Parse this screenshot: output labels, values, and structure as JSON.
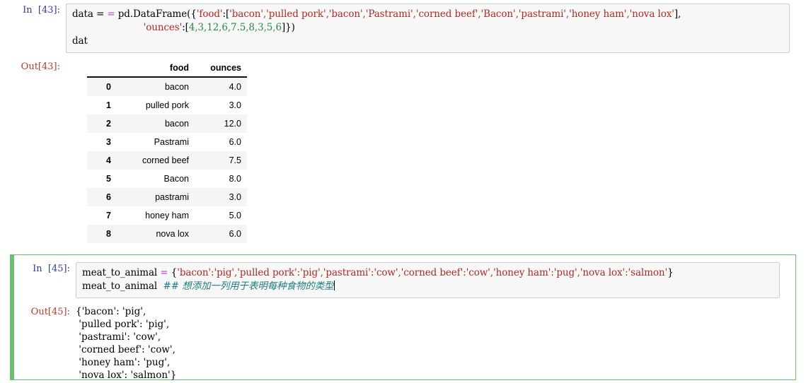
{
  "notebook": {
    "cells": [
      {
        "prompt_in": "In  [43]:",
        "prompt_out": "Out[43]:",
        "code_line_1_a": "data = ",
        "code_line_1_b": "pd.DataFrame({",
        "code_line_1_food_key": "'food'",
        "code_line_1_colon": ":[",
        "code_line_1_foods": "'bacon','pulled pork','bacon','Pastrami','corned beef','Bacon','pastrami','honey ham','nova lox'",
        "code_line_1_tail": "],",
        "code_line_2_key": "'ounces'",
        "code_line_2_colon": ":[",
        "code_line_2_nums": "4,3,12,6,7.5,8,3,5,6",
        "code_line_2_tail": "]})",
        "code_line_3": "dat",
        "equals_op": "="
      },
      {
        "prompt_in": "In  [45]:",
        "prompt_out": "Out[45]:",
        "code_line_1_var": "meat_to_animal ",
        "code_line_1_op": "=",
        "code_line_1_open": " {",
        "code_line_1_dict": "'bacon':'pig','pulled pork':'pig','pastrami':'cow','corned beef':'cow','honey ham':'pug','nova lox':'salmon'",
        "code_line_1_close": "}",
        "code_line_2_var": "meat_to_animal  ",
        "code_line_2_comment": "## 想添加一列用于表明每种食物的类型"
      }
    ]
  },
  "dataframe": {
    "index_header": "",
    "columns": [
      "food",
      "ounces"
    ],
    "index": [
      "0",
      "1",
      "2",
      "3",
      "4",
      "5",
      "6",
      "7",
      "8"
    ],
    "rows": [
      {
        "index": "0",
        "food": "bacon",
        "ounces": "4.0"
      },
      {
        "index": "1",
        "food": "pulled pork",
        "ounces": "3.0"
      },
      {
        "index": "2",
        "food": "bacon",
        "ounces": "12.0"
      },
      {
        "index": "3",
        "food": "Pastrami",
        "ounces": "6.0"
      },
      {
        "index": "4",
        "food": "corned beef",
        "ounces": "7.5"
      },
      {
        "index": "5",
        "food": "Bacon",
        "ounces": "8.0"
      },
      {
        "index": "6",
        "food": "pastrami",
        "ounces": "3.0"
      },
      {
        "index": "7",
        "food": "honey ham",
        "ounces": "5.0"
      },
      {
        "index": "8",
        "food": "nova lox",
        "ounces": "6.0"
      }
    ]
  },
  "dict_output": {
    "lines": [
      "{'bacon': 'pig',",
      " 'pulled pork': 'pig',",
      " 'pastrami': 'cow',",
      " 'corned beef': 'cow',",
      " 'honey ham': 'pug',",
      " 'nova lox': 'salmon'}"
    ],
    "line_0": "{'bacon': 'pig',",
    "line_1": " 'pulled pork': 'pig',",
    "line_2": " 'pastrami': 'cow',",
    "line_3": " 'corned beef': 'cow',",
    "line_4": " 'honey ham': 'pug',",
    "line_5": " 'nova lox': 'salmon'}"
  },
  "colors": {
    "prompt_in": "#303f9f",
    "prompt_out": "#c0392b",
    "string_token": "#b02a1f",
    "number_token": "#2b8a3e",
    "operator_token": "#bb44dd",
    "comment_token": "#207d7d",
    "selected_cell_border": "#6cbf6c",
    "code_background": "#f7f7f7",
    "table_stripe": "#f5f5f5"
  }
}
